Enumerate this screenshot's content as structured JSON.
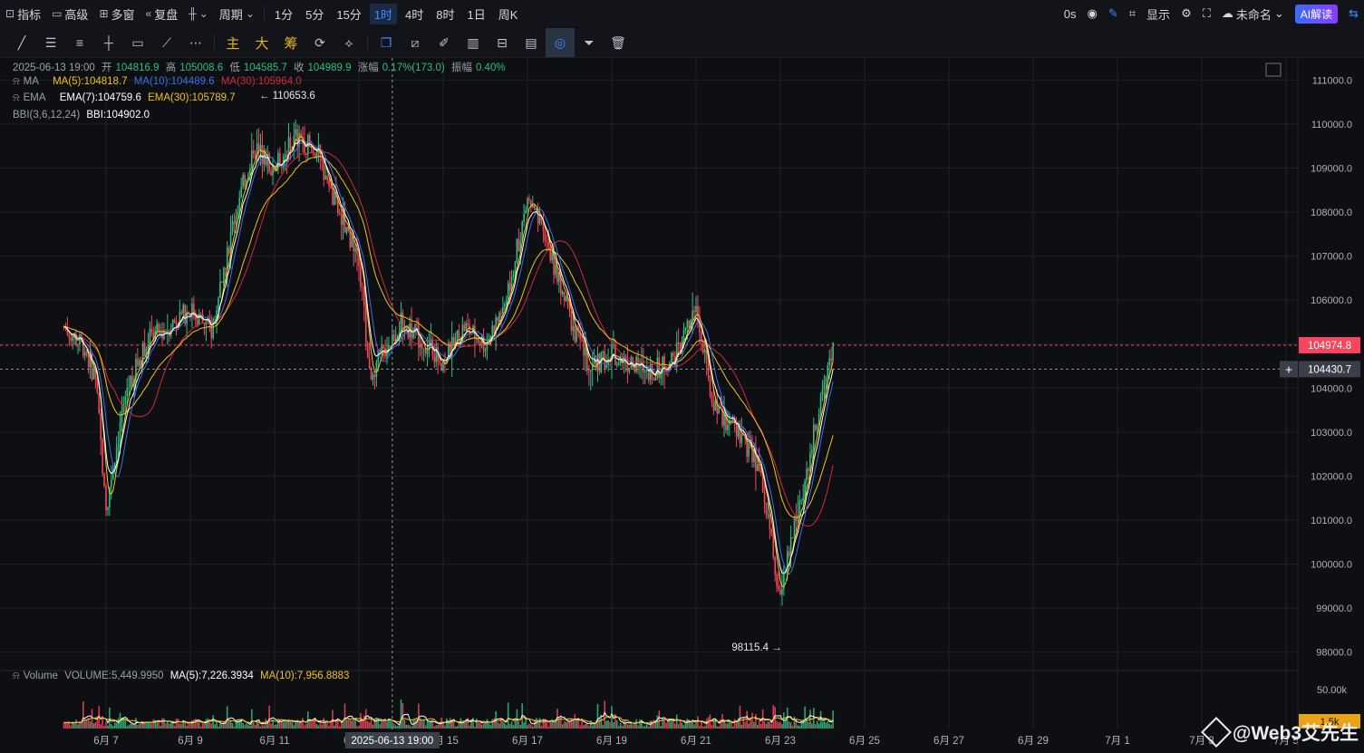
{
  "topbar": {
    "indicators_label": "指标",
    "advanced_label": "高级",
    "multi_window_label": "多窗",
    "replay_label": "复盘",
    "period_label": "周期",
    "timeframes": [
      "1分",
      "5分",
      "15分",
      "1时",
      "4时",
      "8时",
      "1日",
      "周K"
    ],
    "active_timeframe": "1时",
    "latency": "0s",
    "display_label": "显示",
    "layout_name": "未命名",
    "ai_label": "AI解读"
  },
  "toolbar": {
    "main_label": "主",
    "big_label": "大",
    "chip_label": "筹"
  },
  "legend": {
    "date": "2025-06-13 19:00",
    "open_label": "开",
    "open": "104816.9",
    "high_label": "高",
    "high": "105008.6",
    "low_label": "低",
    "low": "104585.7",
    "close_label": "收",
    "close": "104989.9",
    "change_label": "涨幅",
    "change": "0.17%(173.0)",
    "amp_label": "振幅",
    "amp": "0.40%",
    "ma_name": "MA",
    "ma5": "MA(5):104818.7",
    "ma10": "MA(10):104489.6",
    "ma30": "MA(30):105964.0",
    "ema_name": "EMA",
    "ema7": "EMA(7):104759.6",
    "ema30": "EMA(30):105789.7",
    "bbi_name": "BBI(3,6,12,24)",
    "bbi": "BBI:104902.0",
    "vol_name": "Volume",
    "vol": "VOLUME:5,449.9950",
    "vol_ma5": "MA(5):7,226.3934",
    "vol_ma10": "MA(10):7,956.8883"
  },
  "annotations": {
    "high_mark": "110653.6",
    "low_mark": "98115.4"
  },
  "price_tags": {
    "last": "104974.8",
    "cursor": "104430.7",
    "vol_axis": "50.00k",
    "vol_tag": "1.5k"
  },
  "crosshair_label": "2025-06-13 19:00",
  "watermark": "@Web3艾先生",
  "colors": {
    "up": "#2ebd85",
    "down": "#f6465d",
    "ma5": "#f0c419",
    "ma10": "#3f6fe6",
    "ma30": "#d02a3c",
    "ema7": "#ffffff",
    "ema30": "#f0c419",
    "bg": "#0e0f12",
    "grid": "#1e2027"
  },
  "chart_data": {
    "type": "candlestick",
    "interval": "1h",
    "ylim": [
      97500,
      111500
    ],
    "y_ticks": [
      98000,
      99000,
      100000,
      101000,
      102000,
      103000,
      104000,
      105000,
      106000,
      107000,
      108000,
      109000,
      110000,
      111000
    ],
    "x_ticks": [
      "6月 7",
      "6月 9",
      "6月 11",
      "6月 13",
      "6月 15",
      "6月 17",
      "6月 19",
      "6月 21",
      "6月 23",
      "6月 25",
      "6月 27",
      "6月 29",
      "7月 1",
      "7月 3",
      "7月 5"
    ],
    "close_path": [
      {
        "x": "6月 6 00:00",
        "y": 105400
      },
      {
        "x": "6月 6 12:00",
        "y": 104900
      },
      {
        "x": "6月 6 18:00",
        "y": 104200
      },
      {
        "x": "6月 7 00:00",
        "y": 101300
      },
      {
        "x": "6月 7 06:00",
        "y": 102700
      },
      {
        "x": "6月 7 12:00",
        "y": 104000
      },
      {
        "x": "6月 8 00:00",
        "y": 105100
      },
      {
        "x": "6月 8 12:00",
        "y": 105400
      },
      {
        "x": "6月 9 00:00",
        "y": 105800
      },
      {
        "x": "6月 9 12:00",
        "y": 105300
      },
      {
        "x": "6月 10 00:00",
        "y": 107700
      },
      {
        "x": "6月 10 12:00",
        "y": 109500
      },
      {
        "x": "6月 11 00:00",
        "y": 109000
      },
      {
        "x": "6月 11 12:00",
        "y": 109700
      },
      {
        "x": "6月 12 00:00",
        "y": 109400
      },
      {
        "x": "6月 12 12:00",
        "y": 108000
      },
      {
        "x": "6月 13 00:00",
        "y": 107000
      },
      {
        "x": "6月 13 06:00",
        "y": 104300
      },
      {
        "x": "6月 13 12:00",
        "y": 104700
      },
      {
        "x": "6月 14 00:00",
        "y": 105500
      },
      {
        "x": "6月 14 12:00",
        "y": 105100
      },
      {
        "x": "6月 15 00:00",
        "y": 104600
      },
      {
        "x": "6月 15 12:00",
        "y": 105400
      },
      {
        "x": "6月 16 00:00",
        "y": 105000
      },
      {
        "x": "6月 16 12:00",
        "y": 106000
      },
      {
        "x": "6月 17 00:00",
        "y": 108300
      },
      {
        "x": "6月 17 12:00",
        "y": 107200
      },
      {
        "x": "6月 18 00:00",
        "y": 105600
      },
      {
        "x": "6月 18 12:00",
        "y": 104400
      },
      {
        "x": "6月 19 00:00",
        "y": 104800
      },
      {
        "x": "6月 19 12:00",
        "y": 104500
      },
      {
        "x": "6月 20 00:00",
        "y": 104400
      },
      {
        "x": "6月 20 12:00",
        "y": 104700
      },
      {
        "x": "6月 21 00:00",
        "y": 105800
      },
      {
        "x": "6月 21 06:00",
        "y": 104400
      },
      {
        "x": "6月 21 12:00",
        "y": 103400
      },
      {
        "x": "6月 22 00:00",
        "y": 103000
      },
      {
        "x": "6月 22 12:00",
        "y": 102200
      },
      {
        "x": "6月 23 00:00",
        "y": 99200
      },
      {
        "x": "6月 23 06:00",
        "y": 100500
      },
      {
        "x": "6月 23 12:00",
        "y": 101500
      },
      {
        "x": "6月 24 00:00",
        "y": 104000
      },
      {
        "x": "6月 24 06:00",
        "y": 105000
      }
    ],
    "high": 110653.6,
    "low": 98115.4,
    "last_price": 104974.8,
    "volume": {
      "label": "VOLUME",
      "last": 5449.995,
      "ma5": 7226.3934,
      "ma10": 7956.8883,
      "y_ticks": [
        "50.00k"
      ]
    },
    "series": [
      {
        "name": "MA(5)",
        "value": 104818.7
      },
      {
        "name": "MA(10)",
        "value": 104489.6
      },
      {
        "name": "MA(30)",
        "value": 105964.0
      },
      {
        "name": "EMA(7)",
        "value": 104759.6
      },
      {
        "name": "EMA(30)",
        "value": 105789.7
      },
      {
        "name": "BBI",
        "value": 104902.0
      }
    ]
  }
}
